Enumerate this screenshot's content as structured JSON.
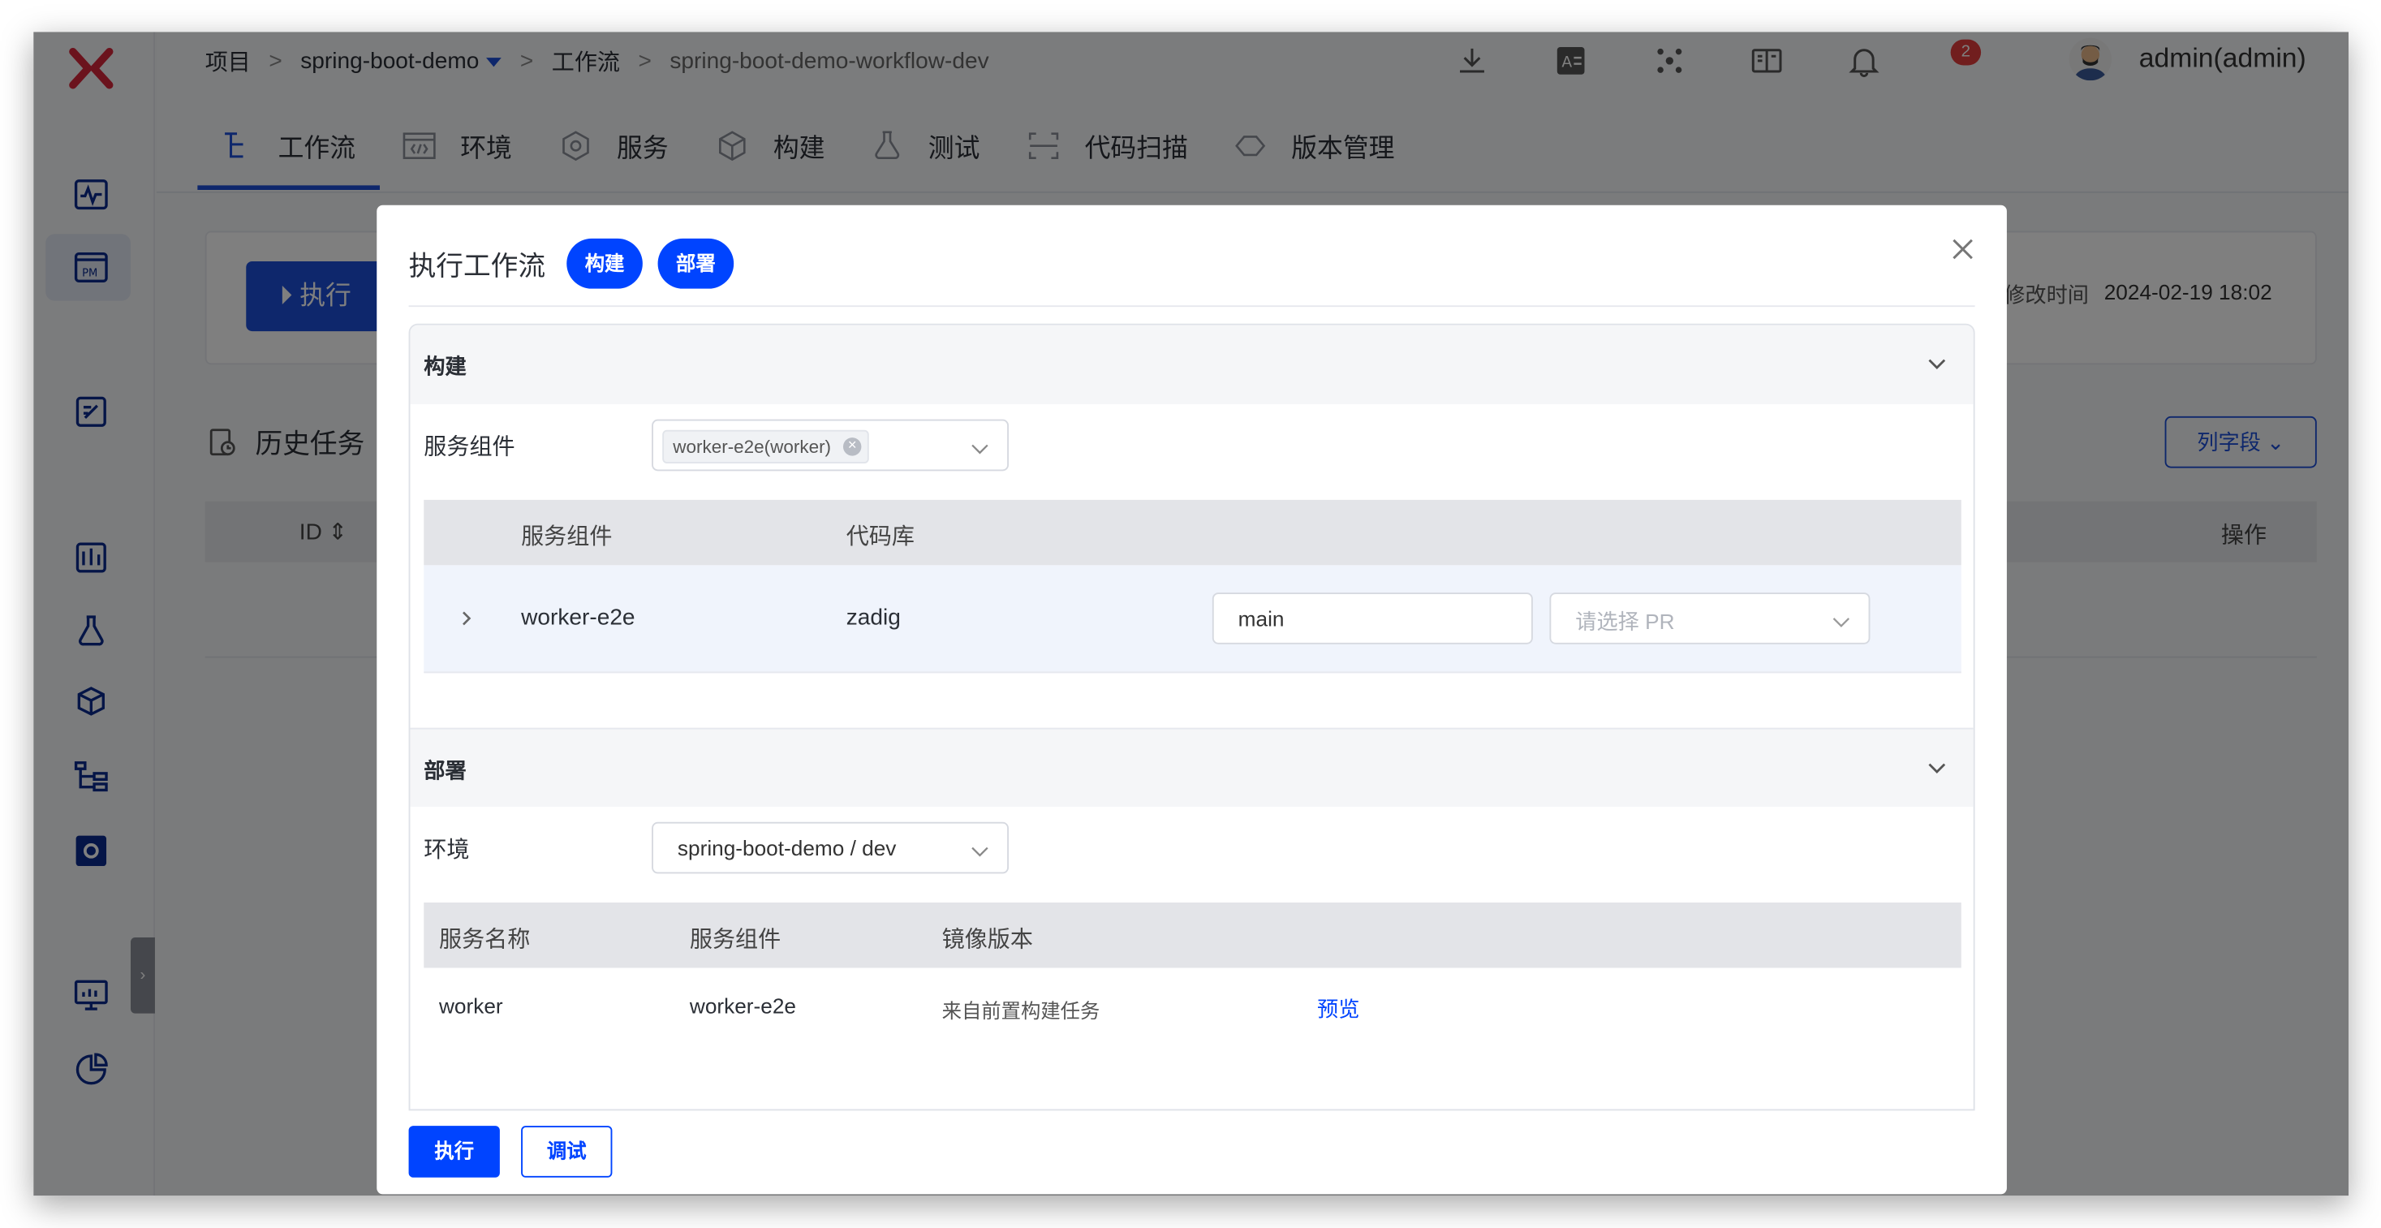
{
  "app": {
    "brand_color": "#d6263a",
    "accent": "#1c4fd8"
  },
  "breadcrumb": {
    "items": [
      "项目",
      "spring-boot-demo",
      "工作流",
      "spring-boot-demo-workflow-dev"
    ],
    "separator": ">"
  },
  "header": {
    "notification_count": "2",
    "user": "admin(admin)",
    "more": "⋮"
  },
  "tabs": [
    {
      "label": "工作流",
      "icon": "workflow-icon",
      "active": true
    },
    {
      "label": "环境",
      "icon": "environment-icon"
    },
    {
      "label": "服务",
      "icon": "service-icon"
    },
    {
      "label": "构建",
      "icon": "build-icon"
    },
    {
      "label": "测试",
      "icon": "test-flask-icon"
    },
    {
      "label": "代码扫描",
      "icon": "code-scan-icon"
    },
    {
      "label": "版本管理",
      "icon": "version-icon"
    }
  ],
  "background": {
    "run_button": "执行",
    "modified_label": "修改时间",
    "modified_value": "2024-02-19 18:02",
    "history_title": "历史任务",
    "columns_button": "列字段",
    "table_head_id": "ID",
    "table_head_op": "操作"
  },
  "modal": {
    "title": "执行工作流",
    "pills": [
      "构建",
      "部署"
    ],
    "build_section": {
      "title": "构建",
      "service_component_label": "服务组件",
      "selected_tag": "worker-e2e(worker)",
      "columns": [
        "服务组件",
        "代码库"
      ],
      "row": {
        "component": "worker-e2e",
        "repo": "zadig",
        "branch": "main",
        "pr_placeholder": "请选择 PR"
      }
    },
    "deploy_section": {
      "title": "部署",
      "env_label": "环境",
      "env_value": "spring-boot-demo / dev",
      "columns": [
        "服务名称",
        "服务组件",
        "镜像版本"
      ],
      "row": {
        "service": "worker",
        "component": "worker-e2e",
        "image": "来自前置构建任务",
        "preview": "预览"
      }
    },
    "buttons": {
      "run": "执行",
      "debug": "调试"
    }
  }
}
